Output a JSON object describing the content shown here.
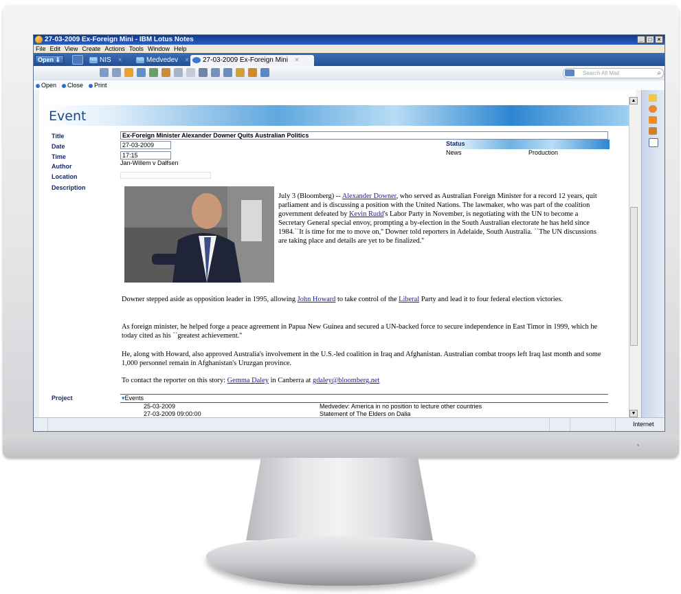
{
  "window": {
    "title": "27-03-2009 Ex-Foreign Mini - IBM Lotus Notes",
    "controls": [
      "_",
      "□",
      "×"
    ]
  },
  "menu": [
    "File",
    "Edit",
    "View",
    "Create",
    "Actions",
    "Tools",
    "Window",
    "Help"
  ],
  "tabs": {
    "open_label": "Open ⇓",
    "items": [
      {
        "icon": "NIS",
        "label": "NIS",
        "close": "×"
      },
      {
        "icon": "NIS",
        "label": "Medvedev",
        "close": "×"
      },
      {
        "icon": "doc",
        "label": "27-03-2009 Ex-Foreign Mini",
        "close": "×"
      }
    ]
  },
  "search": {
    "placeholder": "Search All Mail"
  },
  "actions": [
    "Open",
    "Close",
    "Print"
  ],
  "form": {
    "heading": "Event",
    "labels": {
      "title": "Title",
      "date": "Date",
      "time": "Time",
      "author": "Author",
      "location": "Location",
      "description": "Description",
      "status": "Status",
      "project": "Project"
    },
    "values": {
      "title": "Ex-Foreign Minister Alexander Downer Quits Australian Politics",
      "date": "27-03-2009",
      "time": "17:15",
      "author": "Jan-Willem v Dalfsen",
      "location": "",
      "status_category": "News",
      "status_stage": "Production"
    }
  },
  "article": {
    "p1_a": "July 3 (Bloomberg) -- ",
    "p1_link1": "Alexander Downer",
    "p1_b": ", who served as Australian Foreign Minister for a record 12 years, quit parliament and is discussing a position with the United Nations. The lawmaker, who was part of the coalition government defeated by ",
    "p1_link2": "Kevin Rudd",
    "p1_c": "'s Labor Party in November, is negotiating with the UN to become a Secretary General special envoy, prompting a by-election in the South Australian electorate he has held since 1984.``It is time for me to move on,'' Downer told reporters in Adelaide, South Australia. ``The UN discussions are taking place and details are yet to be finalized.''",
    "p2_a": "Downer stepped aside as opposition leader in 1995, allowing ",
    "p2_link1": "John Howard",
    "p2_b": " to take control of the ",
    "p2_link2": "Liberal",
    "p2_c": " Party and lead it to four federal election victories.",
    "p3": "As foreign minister, he helped forge a peace agreement in Papua New Guinea and secured a UN-backed force to secure independence in East Timor in 1999, which he today cited as his ``greatest achievement.''",
    "p4": "He, along with Howard, also approved Australia's involvement in the U.S.-led coalition in Iraq and Afghanistan. Australian combat troops left Iraq last month and some 1,000 personnel remain in Afghanistan's Uruzgan province.",
    "p5_a": "To contact the reporter on this story: ",
    "p5_link1": "Gemma Daley",
    "p5_b": " in Canberra at ",
    "p5_link2": "gdaley@bloomberg.net"
  },
  "project": {
    "group": "Events",
    "rows": [
      {
        "date": "25-03-2009",
        "title": "Medvedev: America in no position to lecture other countries"
      },
      {
        "date": "27-03-2009 09:00:00",
        "title": "Statement of The Elders on Dalia"
      }
    ]
  },
  "statusbar": {
    "zone": "Internet"
  },
  "colors": {
    "accent": "#2a5fc4",
    "link": "#1a1aa6",
    "label": "#13296a",
    "banner": "#5fa7de"
  }
}
